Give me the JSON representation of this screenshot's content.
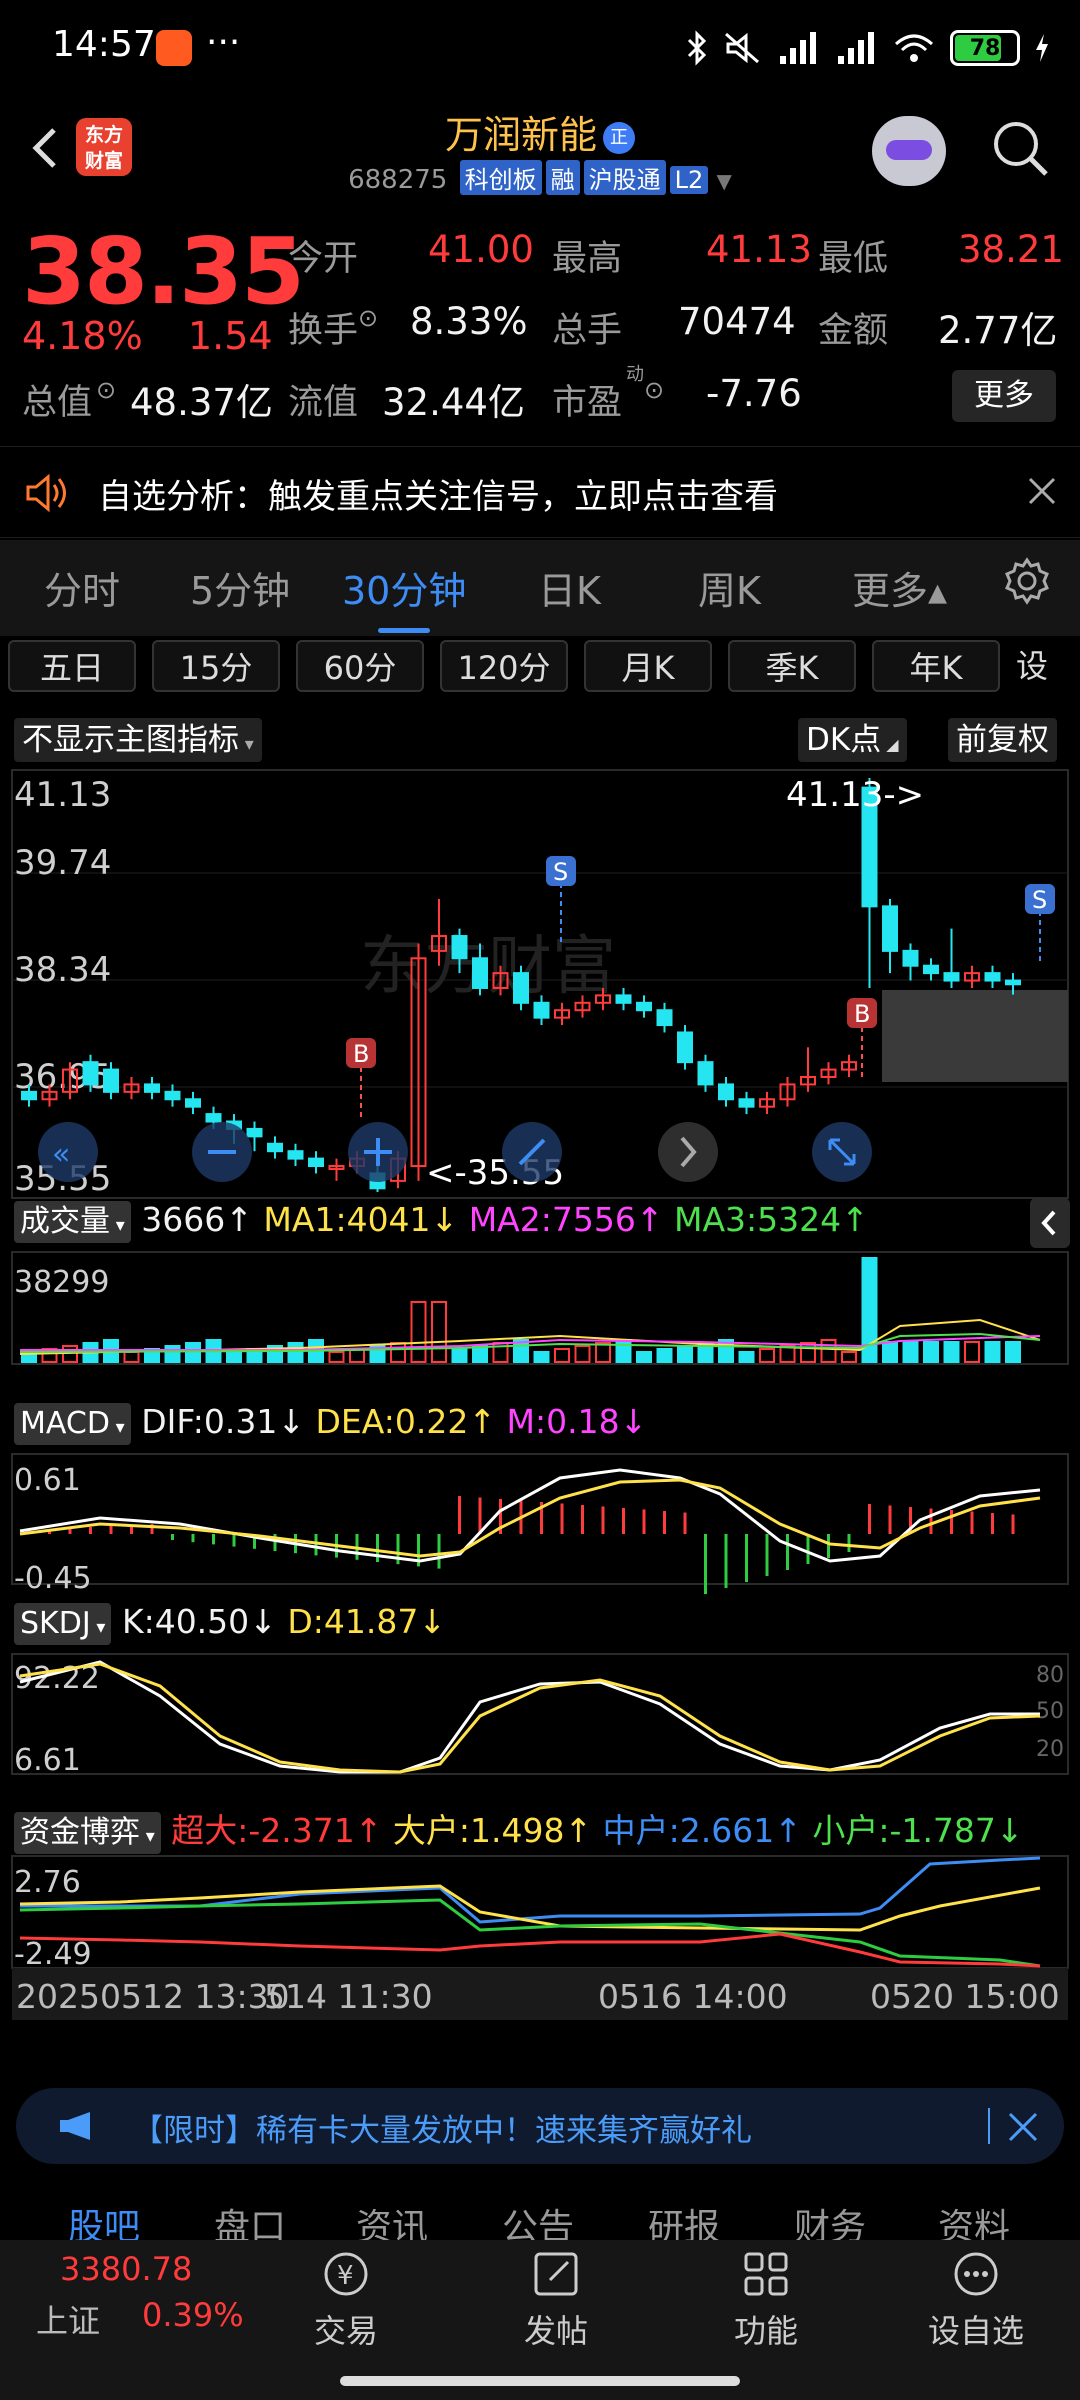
{
  "status_bar": {
    "time": "14:57",
    "more": "···",
    "battery": "78"
  },
  "header": {
    "logo": [
      "东方",
      "财富"
    ],
    "stock_name": "万润新能",
    "name_badge": "正",
    "code": "688275",
    "tags": [
      "科创板",
      "融",
      "沪股通",
      "L2"
    ]
  },
  "quote": {
    "price": "38.35",
    "change_pct": "4.18%",
    "change": "1.54",
    "rows": [
      [
        {
          "label": "今开",
          "value": "41.00",
          "color": "red"
        },
        {
          "label": "最高",
          "value": "41.13",
          "color": "red"
        },
        {
          "label": "最低",
          "value": "38.21",
          "color": "red"
        }
      ],
      [
        {
          "label": "换手",
          "value": "8.33%",
          "color": "white"
        },
        {
          "label": "总手",
          "value": "70474",
          "color": "white"
        },
        {
          "label": "金额",
          "value": "2.77亿",
          "color": "white"
        }
      ],
      [
        {
          "label": "总值",
          "value": "48.37亿",
          "color": "white"
        },
        {
          "label": "流值",
          "value": "32.44亿",
          "color": "white"
        },
        {
          "label": "市盈",
          "sup": "动",
          "value": "-7.76",
          "color": "white"
        }
      ]
    ],
    "more_label": "更多"
  },
  "notice": {
    "text": "自选分析：触发重点关注信号，立即点击查看"
  },
  "period_tabs": [
    {
      "label": "分时",
      "active": false
    },
    {
      "label": "5分钟",
      "active": false
    },
    {
      "label": "30分钟",
      "active": true
    },
    {
      "label": "日K",
      "active": false
    },
    {
      "label": "周K",
      "active": false
    },
    {
      "label": "更多▴",
      "active": false
    }
  ],
  "sub_tabs": [
    "五日",
    "15分",
    "60分",
    "120分",
    "月K",
    "季K",
    "年K",
    "设"
  ],
  "chart": {
    "indicator_select": "不显示主图指标",
    "dk_label": "DK点",
    "adjust_label": "前复权",
    "price_axis": [
      "41.13",
      "39.74",
      "38.34",
      "36.95",
      "35.55"
    ],
    "high_annotation": "41.13->",
    "low_annotation": "<-35.55",
    "watermark": "东方财富",
    "signal_s": "S",
    "signal_b": "B"
  },
  "volume": {
    "select": "成交量",
    "value": "3666↑",
    "ma1": "MA1:4041↓",
    "ma2": "MA2:7556↑",
    "ma3": "MA3:5324↑",
    "axis_max": "38299"
  },
  "macd": {
    "select": "MACD",
    "dif": "DIF:0.31↓",
    "dea": "DEA:0.22↑",
    "m": "M:0.18↓",
    "axis": [
      "0.61",
      "-0.45"
    ]
  },
  "skdj": {
    "select": "SKDJ",
    "k": "K:40.50↓",
    "d": "D:41.87↓",
    "axis": [
      "92.22",
      "6.61"
    ],
    "levels": [
      "80",
      "50",
      "20"
    ]
  },
  "capital": {
    "select": "资金博弈",
    "super": "超大:-2.371↑",
    "large": "大户:1.498↑",
    "mid": "中户:2.661↑",
    "small": "小户:-1.787↓",
    "axis": [
      "2.76",
      "-2.49"
    ]
  },
  "time_axis": [
    "20250512 13:30",
    "514 11:30",
    "0516 14:00",
    "0520 15:00"
  ],
  "banner": {
    "text": "【限时】稀有卡大量发放中！速来集齐赢好礼"
  },
  "bottom_tabs": [
    {
      "label": "股吧",
      "active": true
    },
    {
      "label": "盘口",
      "active": false
    },
    {
      "label": "资讯",
      "active": false
    },
    {
      "label": "公告",
      "active": false
    },
    {
      "label": "研报",
      "active": false
    },
    {
      "label": "财务",
      "active": false
    },
    {
      "label": "资料",
      "active": false
    }
  ],
  "bottom_bar": {
    "index_value": "3380.78",
    "index_name": "上证",
    "index_pct": "0.39%",
    "nav": [
      "交易",
      "发帖",
      "功能",
      "设自选"
    ]
  }
}
